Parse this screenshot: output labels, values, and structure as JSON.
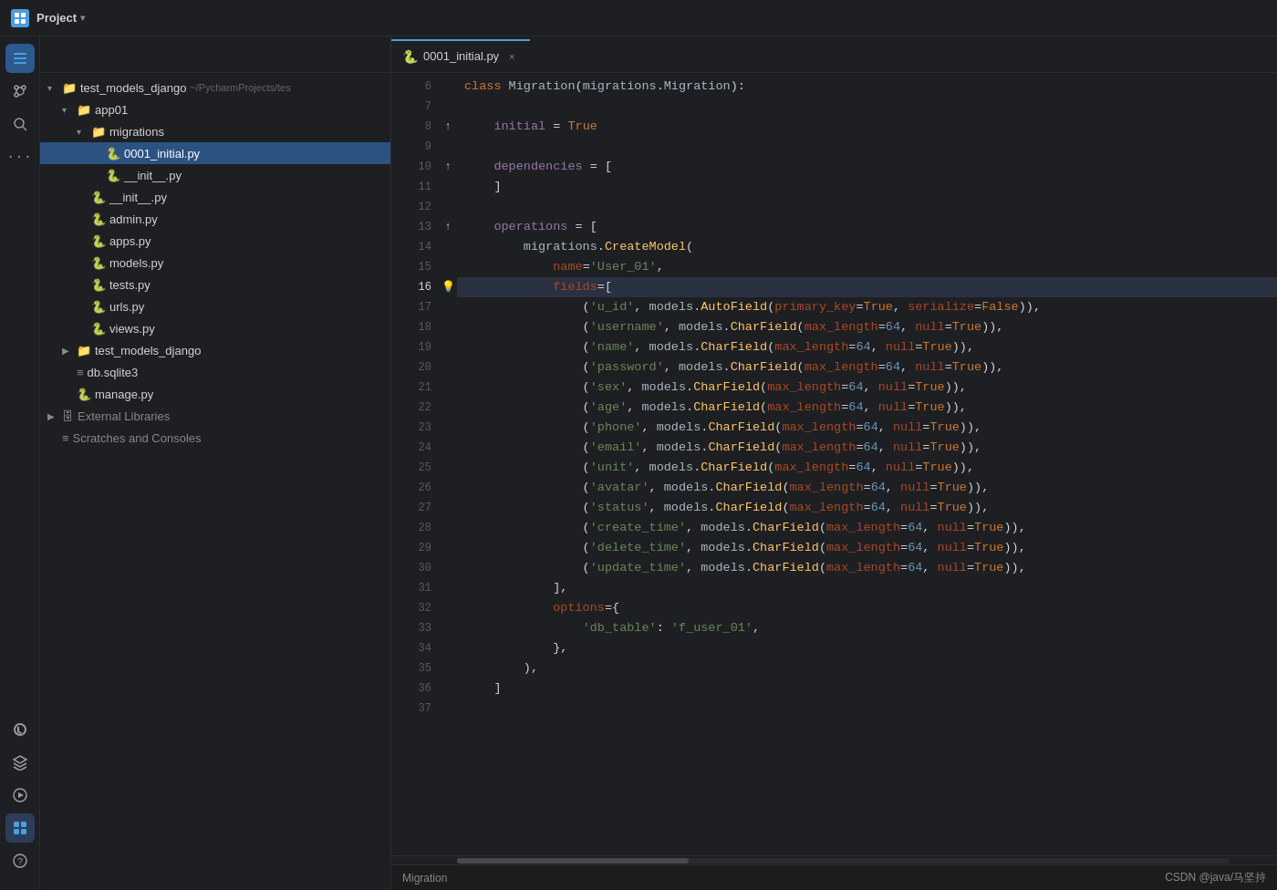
{
  "app": {
    "title": "Project",
    "tab_label": "0001_initial.py",
    "status_text": "Migration",
    "status_right": "CSDN @java/马坚持"
  },
  "sidebar": {
    "icons": [
      {
        "name": "folder-icon",
        "symbol": "📁",
        "active": true
      },
      {
        "name": "git-icon",
        "symbol": "⎇",
        "active": false
      },
      {
        "name": "search-icon",
        "symbol": "🔍",
        "active": false
      },
      {
        "name": "more-icon",
        "symbol": "···",
        "active": false
      }
    ],
    "bottom_icons": [
      {
        "name": "git-bottom",
        "symbol": "⎇"
      },
      {
        "name": "layers",
        "symbol": "≡"
      },
      {
        "name": "run",
        "symbol": "▶"
      },
      {
        "name": "active-panel",
        "symbol": "▦",
        "active": true
      },
      {
        "name": "help",
        "symbol": "?"
      }
    ]
  },
  "file_tree": {
    "root": "test_models_django",
    "root_path": "~/PycharmProjects/tes",
    "items": [
      {
        "id": "root",
        "label": "test_models_django",
        "type": "folder",
        "indent": 0,
        "expanded": true,
        "path": "~/PycharmProjects/tes"
      },
      {
        "id": "app01",
        "label": "app01",
        "type": "folder",
        "indent": 1,
        "expanded": true
      },
      {
        "id": "migrations",
        "label": "migrations",
        "type": "folder",
        "indent": 2,
        "expanded": true
      },
      {
        "id": "0001_initial.py",
        "label": "0001_initial.py",
        "type": "py",
        "indent": 3,
        "selected": true
      },
      {
        "id": "__init__migrations.py",
        "label": "__init__.py",
        "type": "py",
        "indent": 3
      },
      {
        "id": "__init__.py",
        "label": "__init__.py",
        "type": "py",
        "indent": 2
      },
      {
        "id": "admin.py",
        "label": "admin.py",
        "type": "py",
        "indent": 2
      },
      {
        "id": "apps.py",
        "label": "apps.py",
        "type": "py",
        "indent": 2
      },
      {
        "id": "models.py",
        "label": "models.py",
        "type": "py",
        "indent": 2
      },
      {
        "id": "tests.py",
        "label": "tests.py",
        "type": "py",
        "indent": 2
      },
      {
        "id": "urls.py",
        "label": "urls.py",
        "type": "py",
        "indent": 2
      },
      {
        "id": "views.py",
        "label": "views.py",
        "type": "py",
        "indent": 2
      },
      {
        "id": "test_models_django2",
        "label": "test_models_django",
        "type": "folder",
        "indent": 1,
        "expanded": false
      },
      {
        "id": "db.sqlite3",
        "label": "db.sqlite3",
        "type": "db",
        "indent": 1
      },
      {
        "id": "manage.py",
        "label": "manage.py",
        "type": "py",
        "indent": 1
      },
      {
        "id": "external_libs",
        "label": "External Libraries",
        "type": "ext-folder",
        "indent": 0,
        "expanded": false
      },
      {
        "id": "scratches",
        "label": "Scratches and Consoles",
        "type": "scratches",
        "indent": 0,
        "expanded": false
      }
    ]
  },
  "editor": {
    "filename": "0001_initial.py",
    "lines": [
      {
        "num": 6,
        "text": "class Migration(migrations.Migration):"
      },
      {
        "num": 7,
        "text": ""
      },
      {
        "num": 8,
        "text": "    initial = True",
        "gutter": "warn"
      },
      {
        "num": 9,
        "text": ""
      },
      {
        "num": 10,
        "text": "    dependencies = [",
        "gutter": "warn"
      },
      {
        "num": 11,
        "text": "    ]"
      },
      {
        "num": 12,
        "text": ""
      },
      {
        "num": 13,
        "text": "    operations = [",
        "gutter": "warn"
      },
      {
        "num": 14,
        "text": "        migrations.CreateModel("
      },
      {
        "num": 15,
        "text": "            name='User_01',"
      },
      {
        "num": 16,
        "text": "            fields=[",
        "highlight": true,
        "gutter": "bulb"
      },
      {
        "num": 17,
        "text": "                ('u_id', models.AutoField(primary_key=True, serialize=False)),"
      },
      {
        "num": 18,
        "text": "                ('username', models.CharField(max_length=64, null=True)),"
      },
      {
        "num": 19,
        "text": "                ('name', models.CharField(max_length=64, null=True)),"
      },
      {
        "num": 20,
        "text": "                ('password', models.CharField(max_length=64, null=True)),"
      },
      {
        "num": 21,
        "text": "                ('sex', models.CharField(max_length=64, null=True)),"
      },
      {
        "num": 22,
        "text": "                ('age', models.CharField(max_length=64, null=True)),"
      },
      {
        "num": 23,
        "text": "                ('phone', models.CharField(max_length=64, null=True)),"
      },
      {
        "num": 24,
        "text": "                ('email', models.CharField(max_length=64, null=True)),"
      },
      {
        "num": 25,
        "text": "                ('unit', models.CharField(max_length=64, null=True)),"
      },
      {
        "num": 26,
        "text": "                ('avatar', models.CharField(max_length=64, null=True)),"
      },
      {
        "num": 27,
        "text": "                ('status', models.CharField(max_length=64, null=True)),"
      },
      {
        "num": 28,
        "text": "                ('create_time', models.CharField(max_length=64, null=True)),"
      },
      {
        "num": 29,
        "text": "                ('delete_time', models.CharField(max_length=64, null=True)),"
      },
      {
        "num": 30,
        "text": "                ('update_time', models.CharField(max_length=64, null=True)),"
      },
      {
        "num": 31,
        "text": "            ],"
      },
      {
        "num": 32,
        "text": "            options={"
      },
      {
        "num": 33,
        "text": "                'db_table': 'f_user_01',"
      },
      {
        "num": 34,
        "text": "            },"
      },
      {
        "num": 35,
        "text": "        ),"
      },
      {
        "num": 36,
        "text": "    ]"
      },
      {
        "num": 37,
        "text": ""
      }
    ]
  }
}
